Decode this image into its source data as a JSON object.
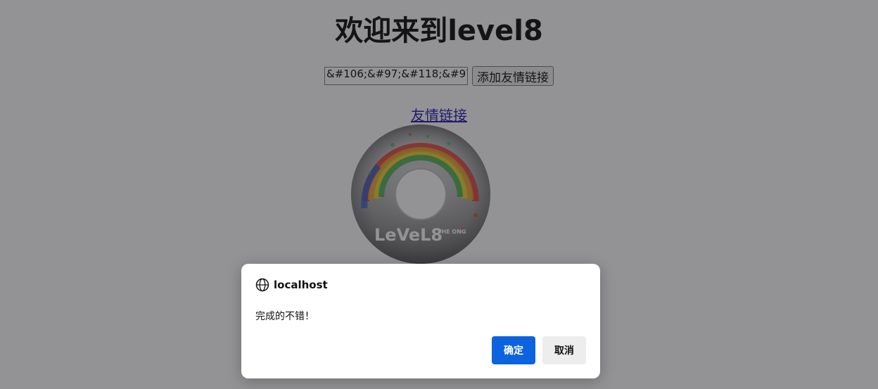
{
  "page": {
    "title": "欢迎来到level8",
    "keyword_input_value": "&#106;&#97;&#118;&#97",
    "add_link_button": "添加友情链接",
    "friend_link_text": "友情链接",
    "disc_logo_text": "LeVeL8",
    "disc_logo_subtext": "THE ONG"
  },
  "dialog": {
    "origin": "localhost",
    "message": "完成的不错！",
    "ok_label": "确定",
    "cancel_label": "取消",
    "ok_color": "#0b63de"
  },
  "icons": {
    "dialog_icon": "globe-icon"
  }
}
